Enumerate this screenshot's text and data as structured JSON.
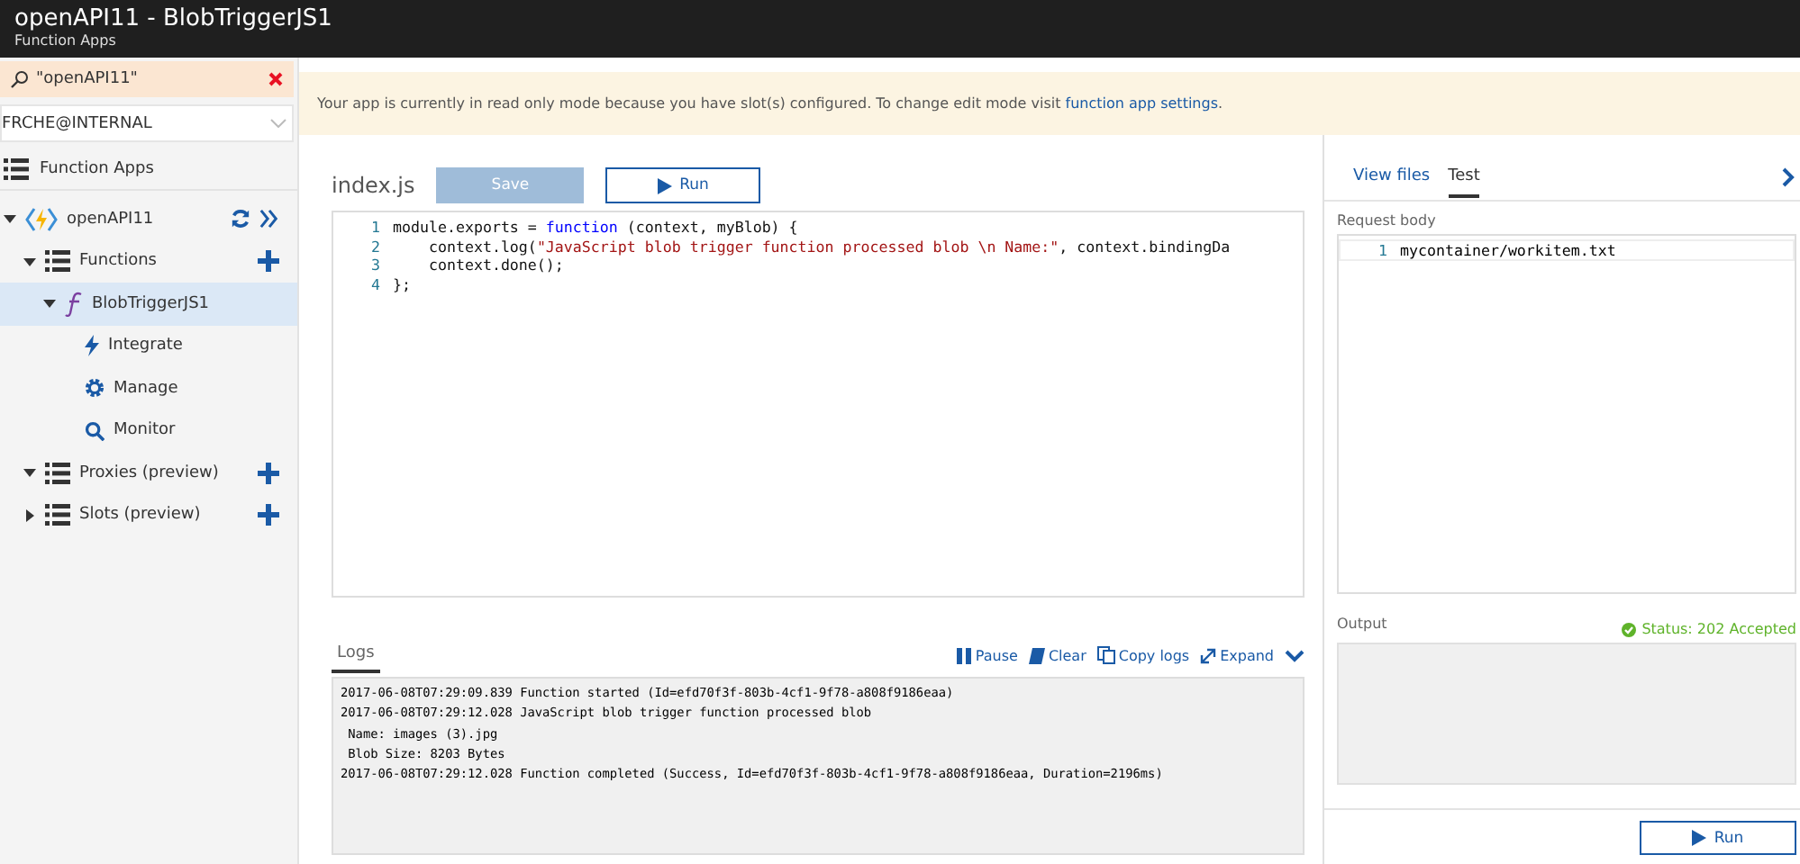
{
  "window": {
    "title": "openAPI11 - BlobTriggerJS1",
    "subtitle": "Function Apps"
  },
  "sidebar": {
    "search": {
      "value": "\"openAPI11\""
    },
    "account": {
      "value": "FRCHE@INTERNAL"
    },
    "section": {
      "label": "Function Apps"
    },
    "tree": [
      {
        "label": "openAPI11",
        "kind": "app",
        "expanded": true,
        "selected": false,
        "children": [
          {
            "label": "Functions",
            "kind": "list",
            "expanded": true,
            "selected": false,
            "children": [
              {
                "label": "BlobTriggerJS1",
                "kind": "function",
                "expanded": true,
                "selected": true,
                "children": [
                  {
                    "label": "Integrate",
                    "kind": "bolt",
                    "selected": false
                  },
                  {
                    "label": "Manage",
                    "kind": "gear",
                    "selected": false
                  },
                  {
                    "label": "Monitor",
                    "kind": "search",
                    "selected": false
                  }
                ]
              }
            ]
          },
          {
            "label": "Proxies (preview)",
            "kind": "list",
            "expanded": true,
            "selected": false
          },
          {
            "label": "Slots (preview)",
            "kind": "list",
            "expanded": false,
            "selected": false
          }
        ]
      }
    ]
  },
  "banner": {
    "text": "Your app is currently in read only mode because you have slot(s) configured. To change edit mode visit ",
    "link": "function app settings",
    "end": "."
  },
  "editor": {
    "filename": "index.js",
    "buttons": [
      {
        "label": "Save",
        "disabled": true
      },
      {
        "label": "Run",
        "disabled": false
      }
    ],
    "lines": [
      {
        "number": "1",
        "tokens": [
          {
            "kind": "plain",
            "text": "module.exports = "
          },
          {
            "kind": "keyword",
            "text": "function"
          },
          {
            "kind": "plain",
            "text": " (context, myBlob) {"
          }
        ]
      },
      {
        "number": "2",
        "tokens": [
          {
            "kind": "plain",
            "text": "    context.log("
          },
          {
            "kind": "string",
            "text": "\"JavaScript blob trigger function processed blob \\n Name:\""
          },
          {
            "kind": "plain",
            "text": ", context.bindingDa"
          }
        ]
      },
      {
        "number": "3",
        "tokens": [
          {
            "kind": "plain",
            "text": "    context.done();"
          }
        ]
      },
      {
        "number": "4",
        "tokens": [
          {
            "kind": "plain",
            "text": "};"
          }
        ]
      }
    ]
  },
  "logs": {
    "tab": "Logs",
    "actions": [
      {
        "kind": "pause",
        "label": "Pause"
      },
      {
        "kind": "clear",
        "label": "Clear"
      },
      {
        "kind": "copy",
        "label": "Copy logs"
      },
      {
        "kind": "expand",
        "label": "Expand"
      }
    ],
    "lines": [
      "2017-06-08T07:29:09.839 Function started (Id=efd70f3f-803b-4cf1-9f78-a808f9186eaa)",
      "2017-06-08T07:29:12.028 JavaScript blob trigger function processed blob",
      " Name: images (3).jpg",
      " Blob Size: 8203 Bytes",
      "2017-06-08T07:29:12.028 Function completed (Success, Id=efd70f3f-803b-4cf1-9f78-a808f9186eaa, Duration=2196ms)"
    ]
  },
  "test_panel": {
    "tabs": [
      {
        "label": "View files",
        "selected": false
      },
      {
        "label": "Test",
        "selected": true
      }
    ],
    "request_body": {
      "label": "Request body",
      "lines": [
        {
          "number": "1",
          "text": "mycontainer/workitem.txt"
        }
      ]
    },
    "output": {
      "label": "Output",
      "status": "Status: 202 Accepted"
    },
    "run_button": {
      "label": "Run"
    }
  }
}
